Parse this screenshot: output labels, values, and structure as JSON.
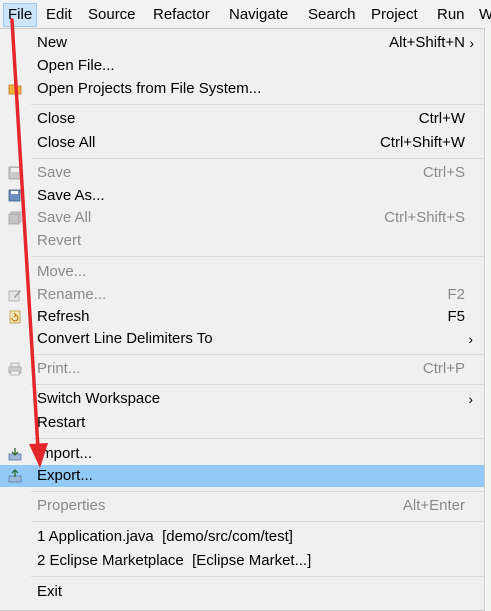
{
  "menubar": {
    "items": [
      {
        "label": "File",
        "active": true
      },
      {
        "label": "Edit"
      },
      {
        "label": "Source"
      },
      {
        "label": "Refactor"
      },
      {
        "label": "Navigate"
      },
      {
        "label": "Search"
      },
      {
        "label": "Project"
      },
      {
        "label": "Run"
      },
      {
        "label": "W"
      }
    ]
  },
  "file_menu": {
    "new": {
      "label": "New",
      "shortcut": "Alt+Shift+N",
      "arrow": "›"
    },
    "open_file": {
      "label": "Open File..."
    },
    "open_projects": {
      "label": "Open Projects from File System..."
    },
    "close": {
      "label": "Close",
      "shortcut": "Ctrl+W"
    },
    "close_all": {
      "label": "Close All",
      "shortcut": "Ctrl+Shift+W"
    },
    "save": {
      "label": "Save",
      "shortcut": "Ctrl+S",
      "disabled": true
    },
    "save_as": {
      "label": "Save As..."
    },
    "save_all": {
      "label": "Save All",
      "shortcut": "Ctrl+Shift+S",
      "disabled": true
    },
    "revert": {
      "label": "Revert",
      "disabled": true
    },
    "move": {
      "label": "Move...",
      "disabled": true
    },
    "rename": {
      "label": "Rename...",
      "shortcut": "F2",
      "disabled": true
    },
    "refresh": {
      "label": "Refresh",
      "shortcut": "F5"
    },
    "convert": {
      "label": "Convert Line Delimiters To",
      "arrow": "›"
    },
    "print": {
      "label": "Print...",
      "shortcut": "Ctrl+P",
      "disabled": true
    },
    "switch_workspace": {
      "label": "Switch Workspace",
      "arrow": "›"
    },
    "restart": {
      "label": "Restart"
    },
    "import": {
      "label": "Import..."
    },
    "export": {
      "label": "Export...",
      "highlighted": true
    },
    "properties": {
      "label": "Properties",
      "shortcut": "Alt+Enter",
      "disabled": true
    },
    "recent_1": {
      "label": "1 Application.java  [demo/src/com/test]"
    },
    "recent_2": {
      "label": "2 Eclipse Marketplace  [Eclipse Market...]"
    },
    "exit": {
      "label": "Exit"
    }
  },
  "icons": {
    "open_projects": "folder-icon",
    "save": "save-icon",
    "save_as": "save-as-icon",
    "save_all": "save-all-icon",
    "rename": "rename-icon",
    "refresh": "refresh-icon",
    "print": "print-icon",
    "import": "import-icon",
    "export": "export-icon"
  },
  "colors": {
    "highlight": "#91c9f7",
    "menu_background": "#f0f0f0",
    "disabled_text": "#8a8a8a",
    "annotation_arrow": "#e3262a"
  }
}
